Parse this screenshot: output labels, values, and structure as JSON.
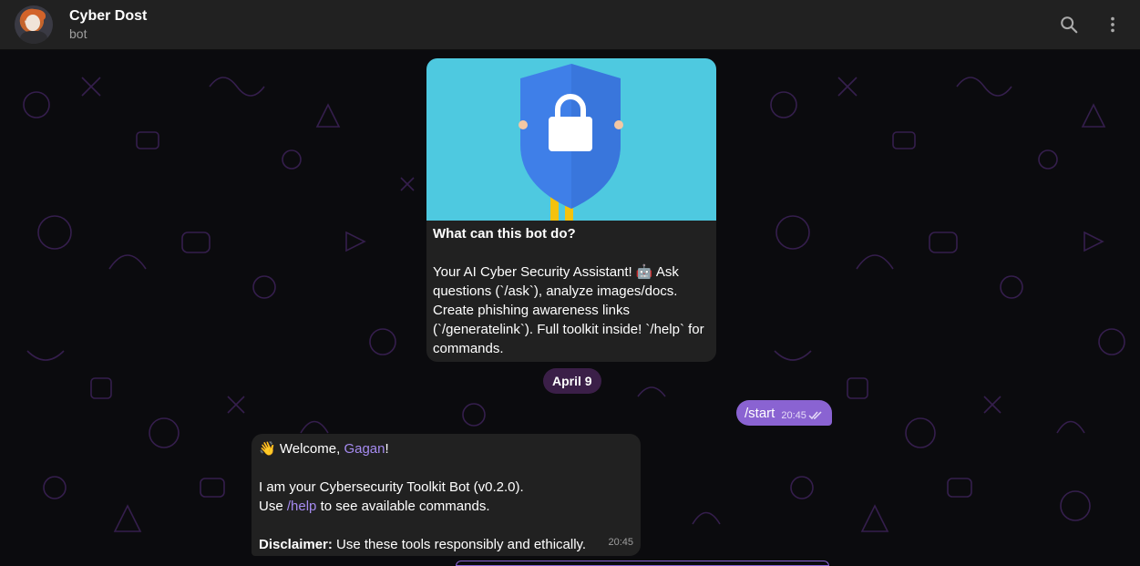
{
  "header": {
    "title": "Cyber Dost",
    "subtitle": "bot",
    "search_icon": "search-icon",
    "menu_icon": "more-vertical-icon"
  },
  "intro": {
    "heading": "What can this bot do?",
    "description": "Your AI Cyber Security Assistant! 🤖 Ask questions (`/ask`), analyze images/docs. Create phishing awareness links (`/generatelink`). Full toolkit inside! `/help` for commands.",
    "image_icon": "shield-lock-icon"
  },
  "date_separator": "April 9",
  "outgoing": {
    "text": "/start",
    "time": "20:45",
    "status_icon": "double-check-icon"
  },
  "welcome": {
    "emoji": "👋",
    "greeting": "Welcome,",
    "name": "Gagan",
    "exclaim": "!",
    "line1": "I am your Cybersecurity Toolkit Bot (v0.2.0).",
    "use_prefix": "Use",
    "help_cmd": "/help",
    "use_suffix": "to see available commands.",
    "disclaimer_label": "Disclaimer:",
    "disclaimer_text": "Use these tools responsibly and ethically.",
    "time": "20:45"
  },
  "colors": {
    "accent": "#8a63d2",
    "header_bg": "#212121",
    "bubble_bg": "#212121",
    "image_bg": "#4ec9e0",
    "shield_blue": "#3f7fe8"
  }
}
